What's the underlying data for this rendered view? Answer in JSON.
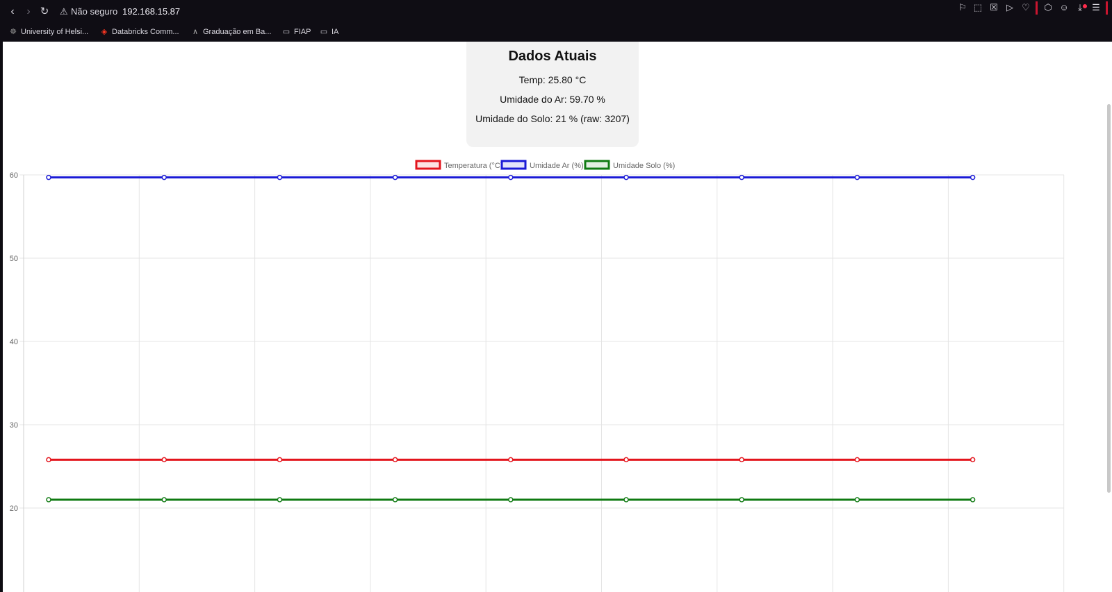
{
  "browser": {
    "security_label": "Não seguro",
    "url": "192.168.15.87",
    "bookmarks": [
      {
        "label": "University of Helsi...",
        "icon": "university-icon"
      },
      {
        "label": "Databricks Comm...",
        "icon": "databricks-icon"
      },
      {
        "label": "Graduação em Ba...",
        "icon": "graduation-icon"
      },
      {
        "label": "FIAP",
        "icon": "folder-icon"
      },
      {
        "label": "IA",
        "icon": "folder-icon"
      }
    ]
  },
  "card": {
    "title": "Dados Atuais",
    "temp": "Temp: 25.80 °C",
    "air": "Umidade do Ar: 59.70 %",
    "soil": "Umidade do Solo: 21 % (raw: 3207)"
  },
  "chart_data": {
    "type": "line",
    "x": [
      "",
      "",
      "",
      "",
      "",
      "",
      "",
      "",
      ""
    ],
    "series": [
      {
        "name": "Temperatura (°C)",
        "color": "#e3141c",
        "values": [
          25.8,
          25.8,
          25.8,
          25.8,
          25.8,
          25.8,
          25.8,
          25.8,
          25.8
        ]
      },
      {
        "name": "Umidade Ar (%)",
        "color": "#1a1ad6",
        "values": [
          59.7,
          59.7,
          59.7,
          59.7,
          59.7,
          59.7,
          59.7,
          59.7,
          59.7
        ]
      },
      {
        "name": "Umidade Solo (%)",
        "color": "#0f7a12",
        "values": [
          21,
          21,
          21,
          21,
          21,
          21,
          21,
          21,
          21
        ]
      }
    ],
    "yticks": [
      60,
      50,
      40,
      30,
      20
    ],
    "ylim": [
      10,
      60
    ],
    "grid": true,
    "legend": "top-center"
  }
}
